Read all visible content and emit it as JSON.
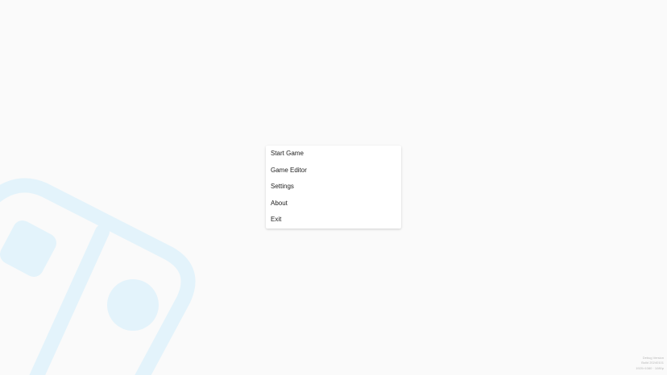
{
  "menu": {
    "items": [
      {
        "id": "start-game",
        "label": "Start Game"
      },
      {
        "id": "game-editor",
        "label": "Game Editor"
      },
      {
        "id": "settings",
        "label": "Settings"
      },
      {
        "id": "about",
        "label": "About"
      },
      {
        "id": "exit",
        "label": "Exit"
      }
    ]
  },
  "version_info": {
    "line1": "Debug Version",
    "line2": "Build 20240101",
    "line3": "1920×1080 · 1080p"
  },
  "background": {
    "icon": "game-controller-icon",
    "color": "#e3f3fb"
  }
}
